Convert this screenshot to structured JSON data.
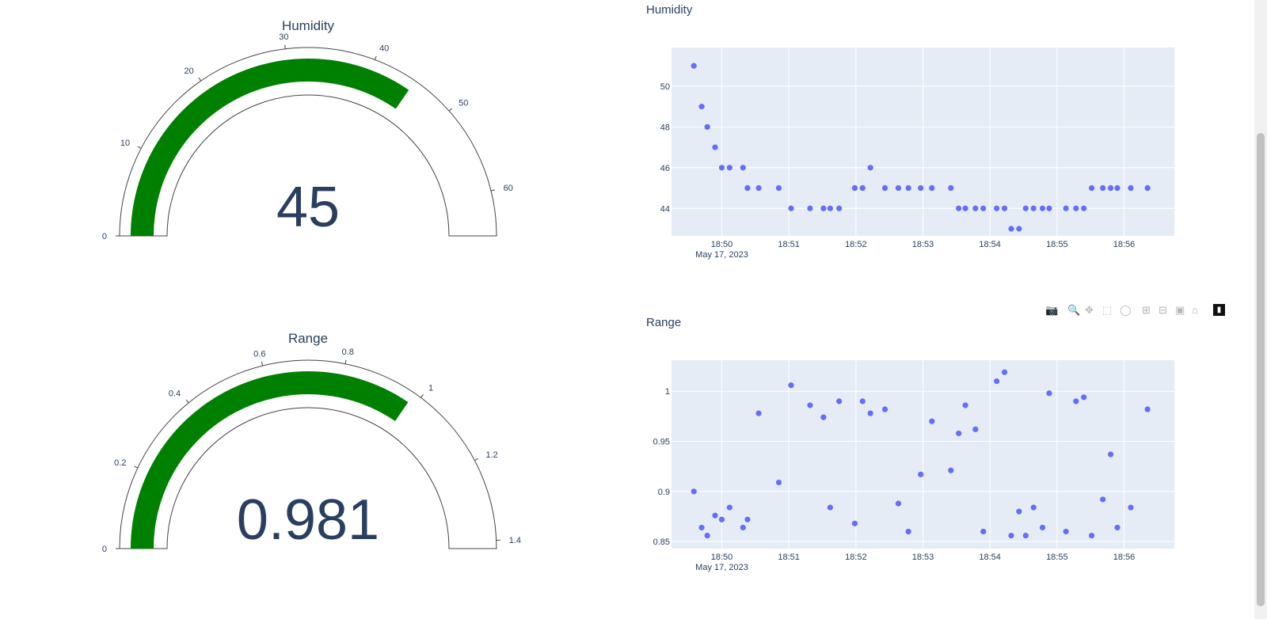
{
  "gauges": [
    {
      "title": "Humidity",
      "value": 45,
      "value_label": "45",
      "range": [
        0,
        65
      ],
      "ticks": [
        0,
        10,
        20,
        30,
        40,
        50,
        60
      ],
      "tick_labels": [
        "0",
        "10",
        "20",
        "30",
        "40",
        "50",
        "60"
      ],
      "bar_color": "#008000"
    },
    {
      "title": "Range",
      "value": 0.981,
      "value_label": "0.981",
      "range": [
        0,
        1.42
      ],
      "ticks": [
        0,
        0.2,
        0.4,
        0.6,
        0.8,
        1,
        1.2,
        1.4
      ],
      "tick_labels": [
        "0",
        "0.2",
        "0.4",
        "0.6",
        "0.8",
        "1",
        "1.2",
        "1.4"
      ],
      "bar_color": "#008000"
    }
  ],
  "chart_data": [
    {
      "type": "scatter",
      "title": "Humidity",
      "x_axis": {
        "kind": "time",
        "ticks": [
          "18:50",
          "18:51",
          "18:52",
          "18:53",
          "18:54",
          "18:55",
          "18:56"
        ],
        "date_label": "May 17, 2023",
        "range": [
          "18:49:15",
          "18:56:45"
        ]
      },
      "y_axis": {
        "ticks": [
          44,
          46,
          48,
          50
        ],
        "range": [
          42.65,
          51.9
        ]
      },
      "grid": true,
      "marker_color": "#636efa",
      "plot_bg": "#e5ecf6",
      "points": [
        [
          "18:49:35",
          51
        ],
        [
          "18:49:42",
          49
        ],
        [
          "18:49:47",
          48
        ],
        [
          "18:49:54",
          47
        ],
        [
          "18:50:00",
          46
        ],
        [
          "18:50:07",
          46
        ],
        [
          "18:50:19",
          46
        ],
        [
          "18:50:23",
          45
        ],
        [
          "18:50:33",
          45
        ],
        [
          "18:50:51",
          45
        ],
        [
          "18:51:02",
          44
        ],
        [
          "18:51:19",
          44
        ],
        [
          "18:51:31",
          44
        ],
        [
          "18:51:37",
          44
        ],
        [
          "18:51:45",
          44
        ],
        [
          "18:51:59",
          45
        ],
        [
          "18:52:06",
          45
        ],
        [
          "18:52:13",
          46
        ],
        [
          "18:52:26",
          45
        ],
        [
          "18:52:38",
          45
        ],
        [
          "18:52:47",
          45
        ],
        [
          "18:52:58",
          45
        ],
        [
          "18:53:08",
          45
        ],
        [
          "18:53:25",
          45
        ],
        [
          "18:53:32",
          44
        ],
        [
          "18:53:38",
          44
        ],
        [
          "18:53:47",
          44
        ],
        [
          "18:53:54",
          44
        ],
        [
          "18:54:06",
          44
        ],
        [
          "18:54:13",
          44
        ],
        [
          "18:54:19",
          43
        ],
        [
          "18:54:26",
          43
        ],
        [
          "18:54:32",
          44
        ],
        [
          "18:54:39",
          44
        ],
        [
          "18:54:47",
          44
        ],
        [
          "18:54:53",
          44
        ],
        [
          "18:55:08",
          44
        ],
        [
          "18:55:17",
          44
        ],
        [
          "18:55:24",
          44
        ],
        [
          "18:55:31",
          45
        ],
        [
          "18:55:41",
          45
        ],
        [
          "18:55:48",
          45
        ],
        [
          "18:55:54",
          45
        ],
        [
          "18:56:06",
          45
        ],
        [
          "18:56:21",
          45
        ]
      ]
    },
    {
      "type": "scatter",
      "title": "Range",
      "x_axis": {
        "kind": "time",
        "ticks": [
          "18:50",
          "18:51",
          "18:52",
          "18:53",
          "18:54",
          "18:55",
          "18:56"
        ],
        "date_label": "May 17, 2023",
        "range": [
          "18:49:15",
          "18:56:45"
        ]
      },
      "y_axis": {
        "ticks": [
          0.85,
          0.9,
          0.95,
          1
        ],
        "tick_labels": [
          "0.85",
          "0.9",
          "0.95",
          "1"
        ],
        "range": [
          0.843,
          1.031
        ]
      },
      "grid": true,
      "marker_color": "#636efa",
      "plot_bg": "#e5ecf6",
      "points": [
        [
          "18:49:35",
          0.9
        ],
        [
          "18:49:42",
          0.864
        ],
        [
          "18:49:47",
          0.856
        ],
        [
          "18:49:54",
          0.876
        ],
        [
          "18:50:00",
          0.872
        ],
        [
          "18:50:07",
          0.884
        ],
        [
          "18:50:19",
          0.864
        ],
        [
          "18:50:23",
          0.872
        ],
        [
          "18:50:33",
          0.978
        ],
        [
          "18:50:51",
          0.909
        ],
        [
          "18:51:02",
          1.006
        ],
        [
          "18:51:19",
          0.986
        ],
        [
          "18:51:31",
          0.974
        ],
        [
          "18:51:37",
          0.884
        ],
        [
          "18:51:45",
          0.99
        ],
        [
          "18:51:59",
          0.868
        ],
        [
          "18:52:06",
          0.99
        ],
        [
          "18:52:13",
          0.978
        ],
        [
          "18:52:26",
          0.982
        ],
        [
          "18:52:38",
          0.888
        ],
        [
          "18:52:47",
          0.86
        ],
        [
          "18:52:58",
          0.917
        ],
        [
          "18:53:08",
          0.97
        ],
        [
          "18:53:25",
          0.921
        ],
        [
          "18:53:32",
          0.958
        ],
        [
          "18:53:38",
          0.986
        ],
        [
          "18:53:47",
          0.962
        ],
        [
          "18:53:54",
          0.86
        ],
        [
          "18:54:06",
          1.01
        ],
        [
          "18:54:13",
          1.019
        ],
        [
          "18:54:19",
          0.856
        ],
        [
          "18:54:26",
          0.88
        ],
        [
          "18:54:32",
          0.856
        ],
        [
          "18:54:39",
          0.884
        ],
        [
          "18:54:47",
          0.864
        ],
        [
          "18:54:53",
          0.998
        ],
        [
          "18:55:08",
          0.86
        ],
        [
          "18:55:17",
          0.99
        ],
        [
          "18:55:24",
          0.994
        ],
        [
          "18:55:31",
          0.856
        ],
        [
          "18:55:41",
          0.892
        ],
        [
          "18:55:48",
          0.937
        ],
        [
          "18:55:54",
          0.864
        ],
        [
          "18:56:06",
          0.884
        ],
        [
          "18:56:21",
          0.982
        ]
      ]
    }
  ],
  "modebar": {
    "icons": [
      "camera-icon",
      "zoom-icon",
      "pan-icon",
      "box-select-icon",
      "lasso-icon",
      "zoom-in-icon",
      "zoom-out-icon",
      "autoscale-icon",
      "reset-axes-icon",
      "plotly-logo-icon"
    ]
  }
}
